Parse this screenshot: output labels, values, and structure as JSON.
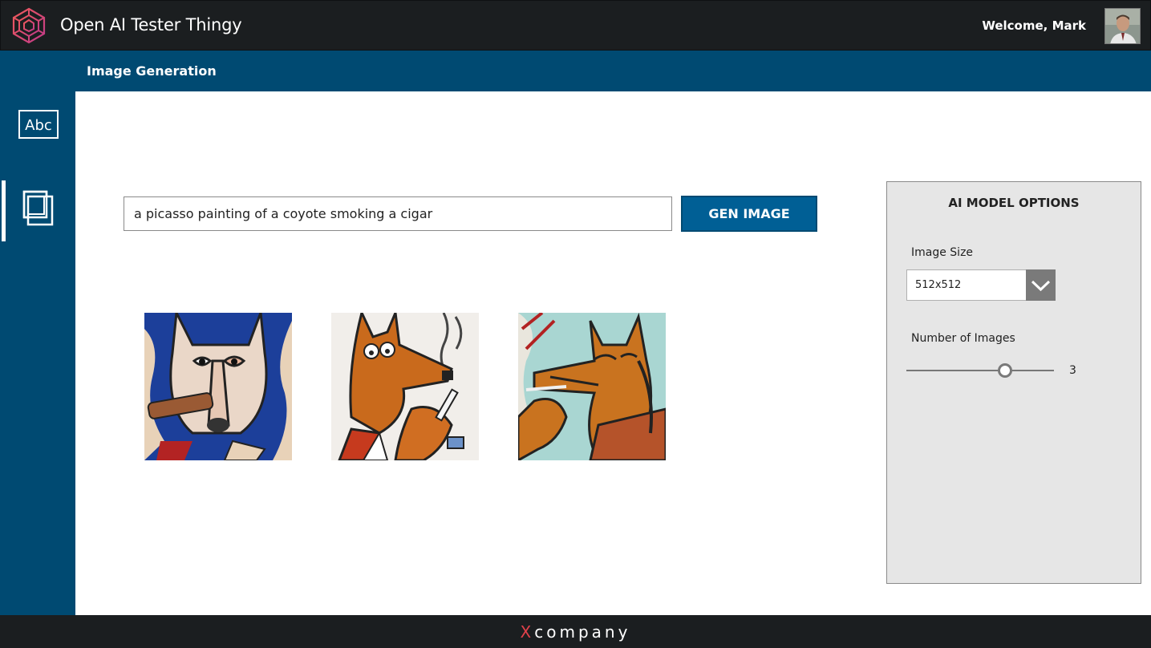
{
  "app": {
    "title": "Open AI Tester Thingy"
  },
  "user": {
    "welcome": "Welcome, Mark"
  },
  "page": {
    "section_title": "Image Generation"
  },
  "sidebar": {
    "items": [
      {
        "label": "Abc",
        "icon": "text-icon",
        "active": false
      },
      {
        "icon": "image-stack-icon",
        "active": true
      }
    ]
  },
  "prompt": {
    "value": "a picasso painting of a coyote smoking a cigar",
    "button_label": "GEN IMAGE"
  },
  "results": {
    "images": [
      {
        "icon": "generated-image",
        "palette": "blue"
      },
      {
        "icon": "generated-image",
        "palette": "white"
      },
      {
        "icon": "generated-image",
        "palette": "teal"
      }
    ]
  },
  "options": {
    "title": "AI MODEL OPTIONS",
    "image_size_label": "Image Size",
    "image_size_value": "512x512",
    "num_images_label": "Number of Images",
    "num_images_value": "3"
  },
  "footer": {
    "brand_x": "X",
    "brand_rest": "company"
  },
  "colors": {
    "topbar": "#1b1e20",
    "primary": "#004a72",
    "button": "#005f95",
    "panel": "#e6e6e6",
    "logo_accent": "#e0414a"
  }
}
